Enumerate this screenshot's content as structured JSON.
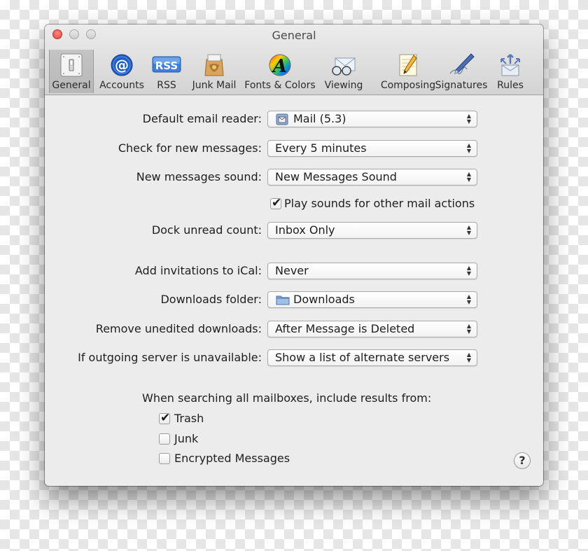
{
  "window": {
    "title": "General"
  },
  "toolbar": {
    "items": [
      {
        "label": "General",
        "icon": "general-switch-icon",
        "selected": true
      },
      {
        "label": "Accounts",
        "icon": "at-sign-icon"
      },
      {
        "label": "RSS",
        "icon": "rss-badge-icon",
        "badge": "RSS"
      },
      {
        "label": "Junk Mail",
        "icon": "junk-mail-bag-icon"
      },
      {
        "label": "Fonts & Colors",
        "icon": "fonts-colors-icon",
        "glyph": "A"
      },
      {
        "label": "Viewing",
        "icon": "glasses-envelope-icon"
      },
      {
        "label": "Composing",
        "icon": "pencil-paper-icon"
      },
      {
        "label": "Signatures",
        "icon": "pen-signature-icon"
      },
      {
        "label": "Rules",
        "icon": "rules-arrows-icon"
      }
    ]
  },
  "settings": {
    "default_reader": {
      "label": "Default email reader:",
      "value": "Mail (5.3)",
      "icon": "mail-app-icon"
    },
    "check_messages": {
      "label": "Check for new messages:",
      "value": "Every 5 minutes"
    },
    "new_sound": {
      "label": "New messages sound:",
      "value": "New Messages Sound"
    },
    "play_sounds": {
      "label": "Play sounds for other mail actions",
      "checked": true
    },
    "dock_count": {
      "label": "Dock unread count:",
      "value": "Inbox Only"
    },
    "ical": {
      "label": "Add invitations to iCal:",
      "value": "Never"
    },
    "downloads_folder": {
      "label": "Downloads folder:",
      "value": "Downloads",
      "icon": "folder-icon"
    },
    "remove_downloads": {
      "label": "Remove unedited downloads:",
      "value": "After Message is Deleted"
    },
    "outgoing": {
      "label": "If outgoing server is unavailable:",
      "value": "Show a list of alternate servers"
    }
  },
  "search": {
    "label": "When searching all mailboxes, include results from:",
    "options": [
      {
        "label": "Trash",
        "checked": true
      },
      {
        "label": "Junk",
        "checked": false
      },
      {
        "label": "Encrypted Messages",
        "checked": false
      }
    ]
  },
  "help": {
    "label": "?"
  },
  "colors": {
    "close": "#e0443e",
    "accent_blue": "#2b62c9"
  }
}
